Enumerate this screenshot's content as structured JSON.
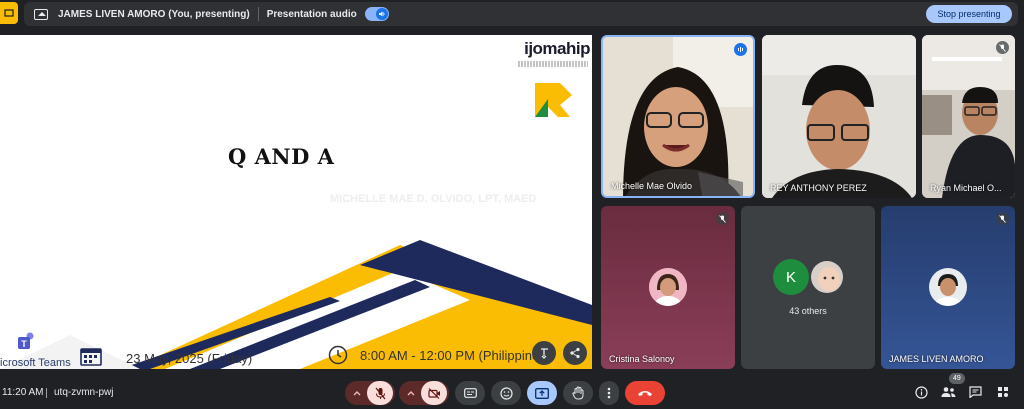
{
  "topbar": {
    "presenter": "JAMES LIVEN AMORO (You, presenting)",
    "audio_label": "Presentation audio",
    "stop_label": "Stop presenting"
  },
  "slide": {
    "logo": "ijomahip",
    "title": "Q AND A",
    "faded_text": "MICHELLE MAE D. OLVIDO, LPT, MAED",
    "date": "23 May, 2025 (Friday)",
    "time": "8:00 AM - 12:00 PM (Philippine",
    "teams": "icrosoft Teams"
  },
  "participants": [
    {
      "name": "Michelle Mae Olvido",
      "speaking": true
    },
    {
      "name": "REY ANTHONY PEREZ",
      "speaking": false
    },
    {
      "name": "Ryan Michael O...",
      "speaking": false
    },
    {
      "name": "Cristina Salonoy",
      "muted": true
    },
    {
      "others_initial": "K",
      "others_label": "43 others"
    },
    {
      "name": "JAMES LIVEN AMORO",
      "muted": true
    }
  ],
  "bottombar": {
    "time": "11:20 AM",
    "meeting_code": "utq-zvmn-pwj",
    "people_count": "49"
  },
  "colors": {
    "accent_blue": "#a8c7fa",
    "end_call_red": "#ea4335",
    "speaking_blue": "#1a73e8",
    "slide_yellow": "#fbbc04",
    "slide_navy": "#1f2a5c"
  },
  "icons": [
    "present-icon",
    "speaker-icon",
    "mic-off-icon",
    "camera-off-icon",
    "captions-icon",
    "emoji-icon",
    "present-now-icon",
    "raise-hand-icon",
    "more-options-icon",
    "end-call-icon",
    "info-icon",
    "people-icon",
    "chat-icon",
    "activities-icon",
    "share-icon",
    "pin-icon",
    "calendar-icon",
    "clock-icon"
  ]
}
